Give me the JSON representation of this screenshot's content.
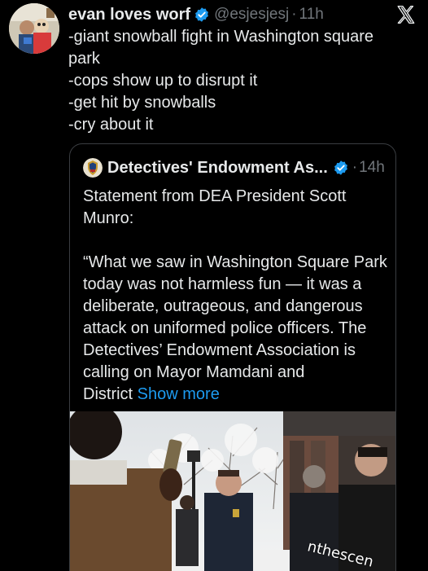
{
  "author": {
    "display_name": "evan loves worf",
    "handle": "@esjesjesj",
    "separator": "·",
    "time": "11h",
    "avatar_icon": "profile-photo-avatar",
    "verified_icon": "verified-badge-icon"
  },
  "platform_logo": "x-logo-icon",
  "tweet": {
    "lines": [
      "-giant snowball fight in Washington square",
      "park",
      "-cops show up to disrupt it",
      "-get hit by snowballs",
      "-cry about it"
    ]
  },
  "quote": {
    "display_name": "Detectives' Endowment As...",
    "separator": "·",
    "time": "14h",
    "avatar_icon": "dea-badge-avatar",
    "verified_icon": "verified-badge-icon",
    "lines": [
      "Statement from DEA President Scott",
      "Munro:",
      "",
      "“What we saw in Washington Square Park",
      "today was not harmless fun — it was a",
      "deliberate, outrageous, and dangerous",
      "attack on uniformed police officers. The",
      "Detectives’ Endowment Association is",
      "calling on Mayor Mamdani and"
    ],
    "last_line": "District",
    "show_more": "Show more",
    "media_watermark": "nthescen"
  },
  "colors": {
    "background": "#000000",
    "text": "#e7e9ea",
    "secondary": "#71767b",
    "link": "#1d9bf0",
    "verified": "#1d9bf0",
    "border": "#3a3d41"
  }
}
